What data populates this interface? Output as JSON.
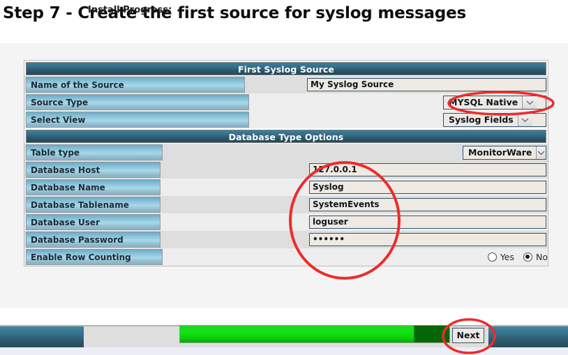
{
  "page": {
    "heading": "Step 7 - Create the first source for syslog messages"
  },
  "form": {
    "section1": {
      "header": "First Syslog Source",
      "rows": [
        {
          "label": "Name of the Source",
          "value": "My Syslog Source",
          "control": "text"
        },
        {
          "label": "Source Type",
          "value": "MYSQL Native",
          "control": "select"
        },
        {
          "label": "Select View",
          "value": "Syslog Fields",
          "control": "select"
        }
      ]
    },
    "section2": {
      "header": "Database Type Options",
      "rows": [
        {
          "label": "Table type",
          "value": "MonitorWare",
          "control": "select"
        },
        {
          "label": "Database Host",
          "value": "127.0.0.1",
          "control": "text"
        },
        {
          "label": "Database Name",
          "value": "Syslog",
          "control": "text"
        },
        {
          "label": "Database Tablename",
          "value": "SystemEvents",
          "control": "text"
        },
        {
          "label": "Database User",
          "value": "loguser",
          "control": "text"
        },
        {
          "label": "Database Password",
          "value": "••••••",
          "control": "password"
        },
        {
          "label": "Enable Row Counting",
          "control": "radio",
          "options": [
            "Yes",
            "No"
          ],
          "selected": "No"
        }
      ]
    }
  },
  "bottom": {
    "progress_label": "Install Progress:",
    "progress_percent": 87,
    "next_label": "Next"
  },
  "colors": {
    "header_bar": "#2b5468",
    "label_cell": "#a7d8ea",
    "progress_fill": "#12e512",
    "progress_track": "#046604",
    "annotation": "#ee2b2b"
  }
}
